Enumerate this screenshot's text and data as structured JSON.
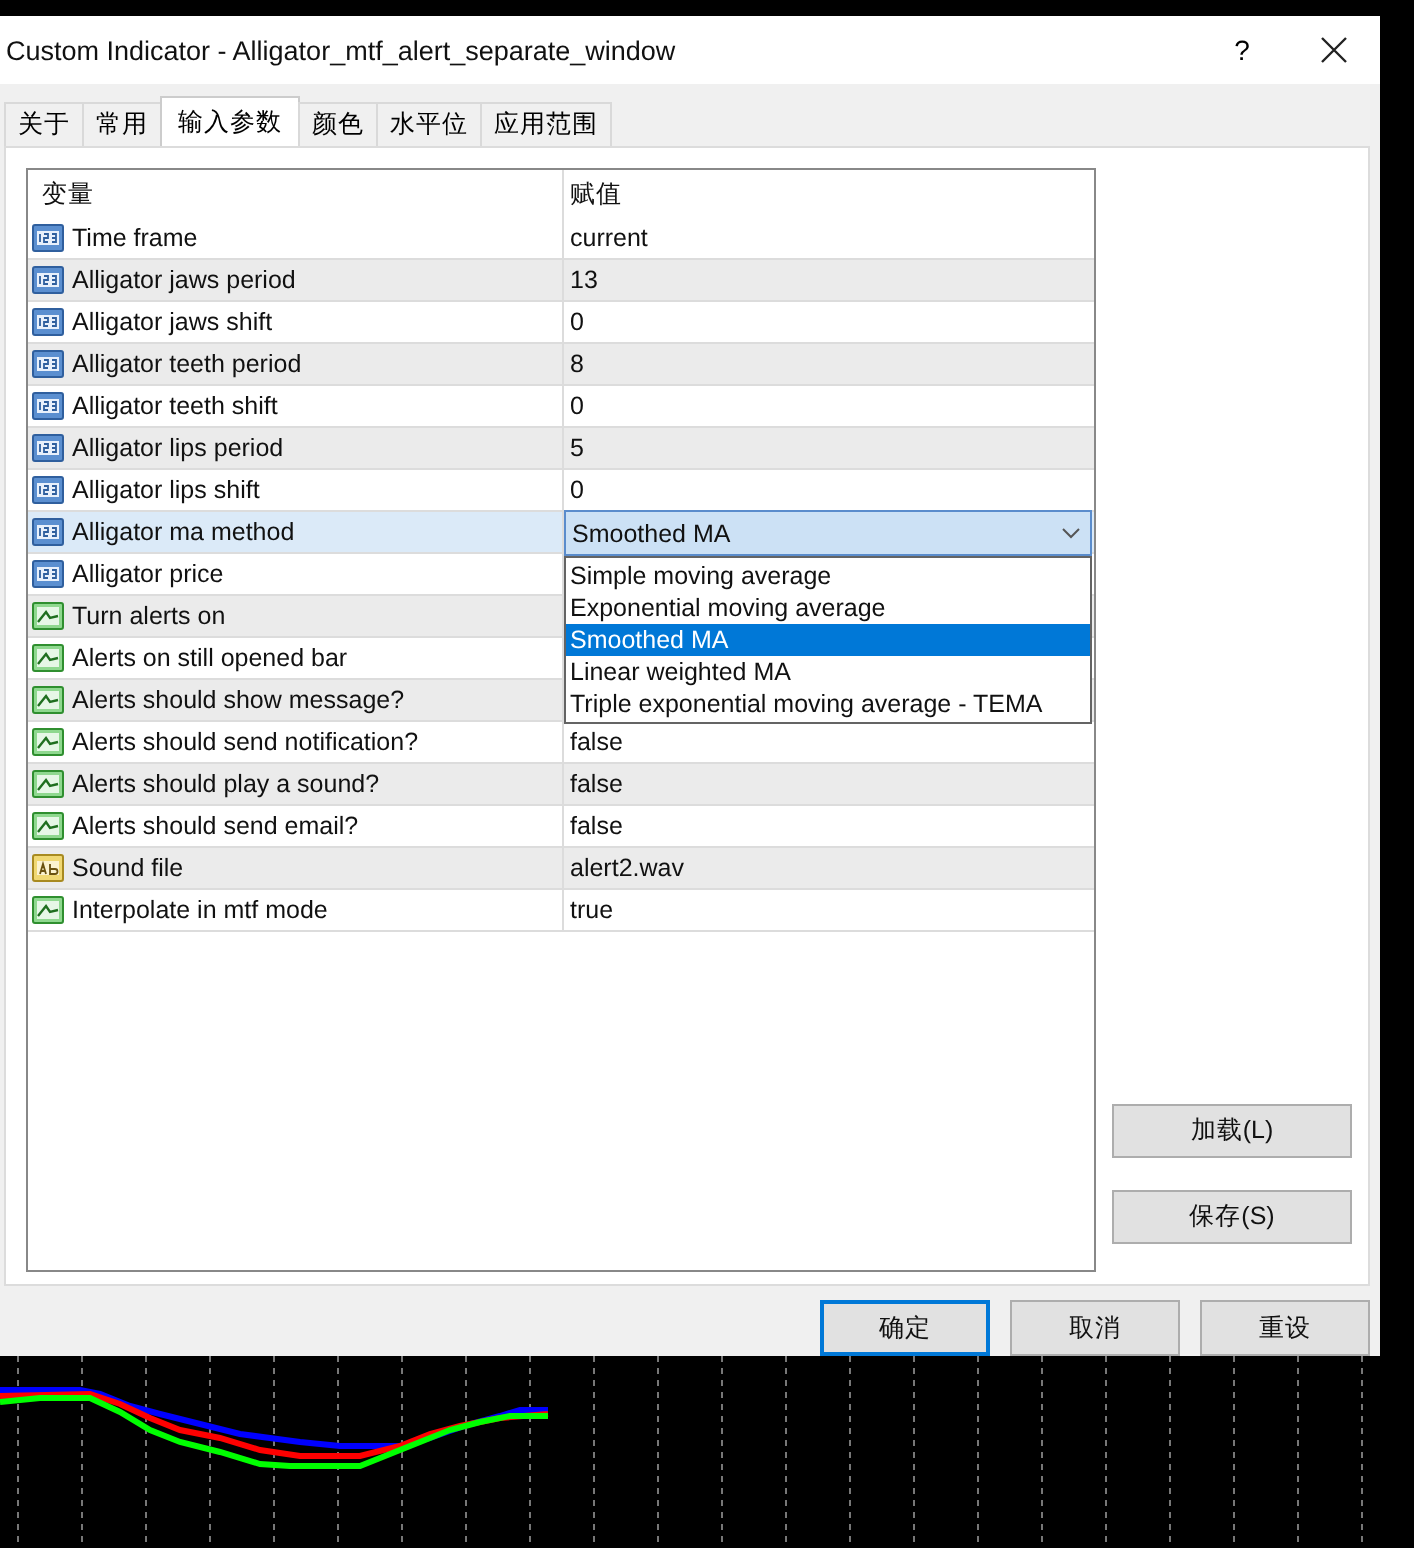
{
  "window": {
    "title": "Custom Indicator - Alligator_mtf_alert_separate_window",
    "help": "?"
  },
  "tabs": [
    {
      "label": "关于",
      "selected": false
    },
    {
      "label": "常用",
      "selected": false
    },
    {
      "label": "输入参数",
      "selected": true
    },
    {
      "label": "颜色",
      "selected": false
    },
    {
      "label": "水平位",
      "selected": false
    },
    {
      "label": "应用范围",
      "selected": false
    }
  ],
  "table": {
    "columns": [
      "变量",
      "赋值"
    ],
    "rows": [
      {
        "kind": "number",
        "name": "Time frame",
        "value": "current",
        "selected": false
      },
      {
        "kind": "number",
        "name": "Alligator jaws period",
        "value": "13",
        "selected": false
      },
      {
        "kind": "number",
        "name": "Alligator jaws shift",
        "value": "0",
        "selected": false
      },
      {
        "kind": "number",
        "name": "Alligator teeth period",
        "value": "8",
        "selected": false
      },
      {
        "kind": "number",
        "name": "Alligator teeth shift",
        "value": "0",
        "selected": false
      },
      {
        "kind": "number",
        "name": "Alligator lips period",
        "value": "5",
        "selected": false
      },
      {
        "kind": "number",
        "name": "Alligator lips shift",
        "value": "0",
        "selected": false
      },
      {
        "kind": "number",
        "name": "Alligator ma method",
        "selected": true,
        "dropdown": {
          "value": "Smoothed MA",
          "options": [
            {
              "label": "Simple moving average",
              "selected": false
            },
            {
              "label": "Exponential moving average",
              "selected": false
            },
            {
              "label": "Smoothed MA",
              "selected": true
            },
            {
              "label": "Linear weighted MA",
              "selected": false
            },
            {
              "label": "Triple exponential moving average - TEMA",
              "selected": false
            }
          ]
        }
      },
      {
        "kind": "number",
        "name": "Alligator price",
        "selected": false
      },
      {
        "kind": "bool",
        "name": "Turn alerts on",
        "selected": false
      },
      {
        "kind": "bool",
        "name": "Alerts on still opened bar",
        "selected": false
      },
      {
        "kind": "bool",
        "name": "Alerts should show message?",
        "selected": false
      },
      {
        "kind": "bool",
        "name": "Alerts should send notification?",
        "value": "false",
        "selected": false
      },
      {
        "kind": "bool",
        "name": "Alerts should play a sound?",
        "value": "false",
        "selected": false
      },
      {
        "kind": "bool",
        "name": "Alerts should send email?",
        "value": "false",
        "selected": false
      },
      {
        "kind": "text",
        "name": "Sound file",
        "value": "alert2.wav",
        "selected": false
      },
      {
        "kind": "bool",
        "name": "Interpolate in mtf mode",
        "value": "true",
        "selected": false
      }
    ]
  },
  "side_buttons": [
    "加载(L)",
    "保存(S)"
  ],
  "buttons": [
    {
      "label": "确定",
      "default": true
    },
    {
      "label": "取消",
      "default": false
    },
    {
      "label": "重设",
      "default": false
    }
  ]
}
